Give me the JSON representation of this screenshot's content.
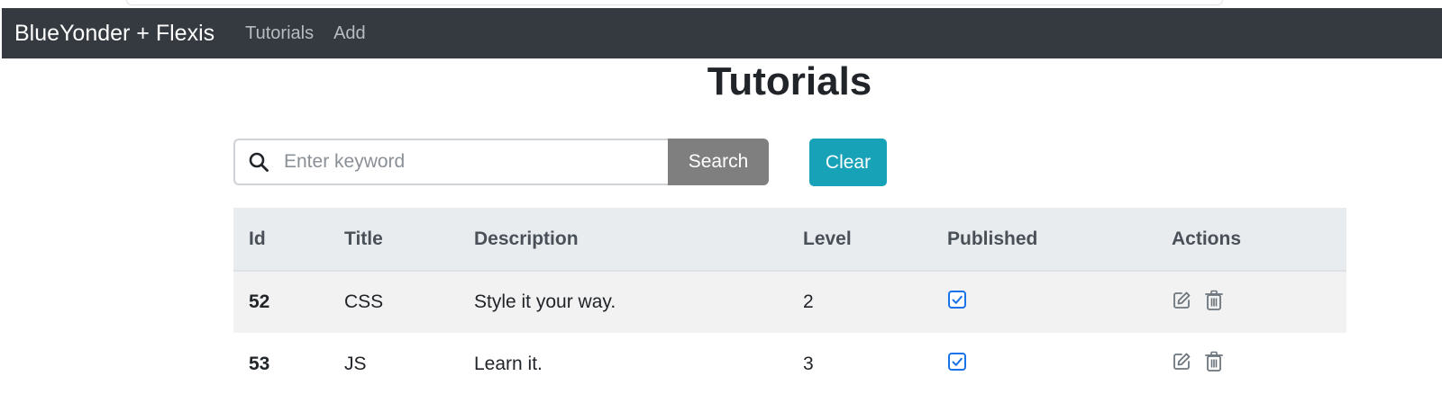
{
  "navbar": {
    "brand": "BlueYonder + Flexis",
    "links": [
      "Tutorials",
      "Add"
    ]
  },
  "page": {
    "title": "Tutorials"
  },
  "search": {
    "placeholder": "Enter keyword",
    "value": "",
    "search_label": "Search",
    "clear_label": "Clear"
  },
  "table": {
    "headers": [
      "Id",
      "Title",
      "Description",
      "Level",
      "Published",
      "Actions"
    ],
    "rows": [
      {
        "id": "52",
        "title": "CSS",
        "description": "Style it your way.",
        "level": "2",
        "published": true
      },
      {
        "id": "53",
        "title": "JS",
        "description": "Learn it.",
        "level": "3",
        "published": true
      }
    ]
  },
  "icons": {
    "search": "search-icon",
    "published": "checkbox-checked-icon",
    "edit": "edit-icon",
    "delete": "trash-icon"
  },
  "colors": {
    "navbar": "#343a40",
    "search_button": "#7f7f7f",
    "clear_button": "#17a2b8",
    "checkbox": "#1a73e8",
    "table_header": "#e9ecef"
  }
}
